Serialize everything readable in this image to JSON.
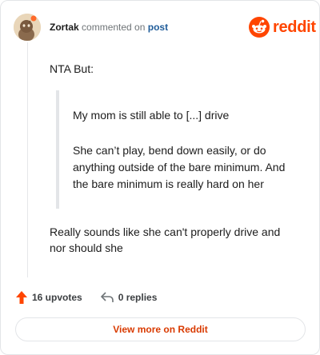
{
  "comment": {
    "username": "Zortak",
    "action_text": "commented on",
    "post_link": "post",
    "paragraph1": "NTA But:",
    "quote_line1": "My mom is still able to [...] drive",
    "quote_line2": "She can’t play, bend down easily, or do anything outside of the bare minimum. And the bare minimum is really hard on her",
    "paragraph2": "Really sounds like she can't properly drive and nor should she"
  },
  "brand": {
    "name": "reddit",
    "icon": "reddit-logo-icon",
    "color": "#ff4500"
  },
  "stats": {
    "upvotes": "16 upvotes",
    "replies": "0 replies",
    "upvote_icon": "upvote-arrow-icon",
    "reply_icon": "reply-arrow-icon",
    "upvote_color": "#ff4500"
  },
  "footer": {
    "view_more_label": "View more on Reddit"
  }
}
